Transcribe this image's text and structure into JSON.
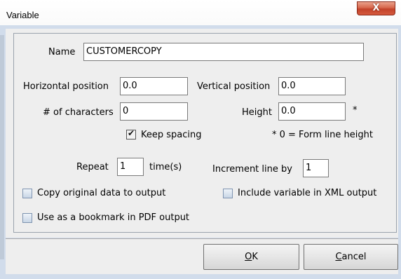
{
  "window": {
    "title": "Variable",
    "close_glyph": "X"
  },
  "form": {
    "name_label": "Name",
    "name_value": "CUSTOMERCOPY",
    "hpos_label": "Horizontal position",
    "hpos_value": "0.0",
    "vpos_label": "Vertical position",
    "vpos_value": "0.0",
    "chars_label": "# of characters",
    "chars_value": "0",
    "height_label": "Height",
    "height_value": "0.0",
    "height_asterisk": "*",
    "keep_spacing_label": "Keep spacing",
    "keep_spacing_checked": true,
    "height_note": "* 0 = Form line height",
    "repeat_label": "Repeat",
    "repeat_value": "1",
    "times_label": "time(s)",
    "increment_label": "Increment line by",
    "increment_value": "1",
    "copy_original_label": "Copy original data to output",
    "copy_original_checked": false,
    "include_xml_label": "Include variable in XML output",
    "include_xml_checked": false,
    "bookmark_label": "Use as a bookmark in PDF output",
    "bookmark_checked": false
  },
  "buttons": {
    "ok_mnemonic": "O",
    "ok_rest": "K",
    "cancel_mnemonic": "C",
    "cancel_rest": "ancel"
  }
}
